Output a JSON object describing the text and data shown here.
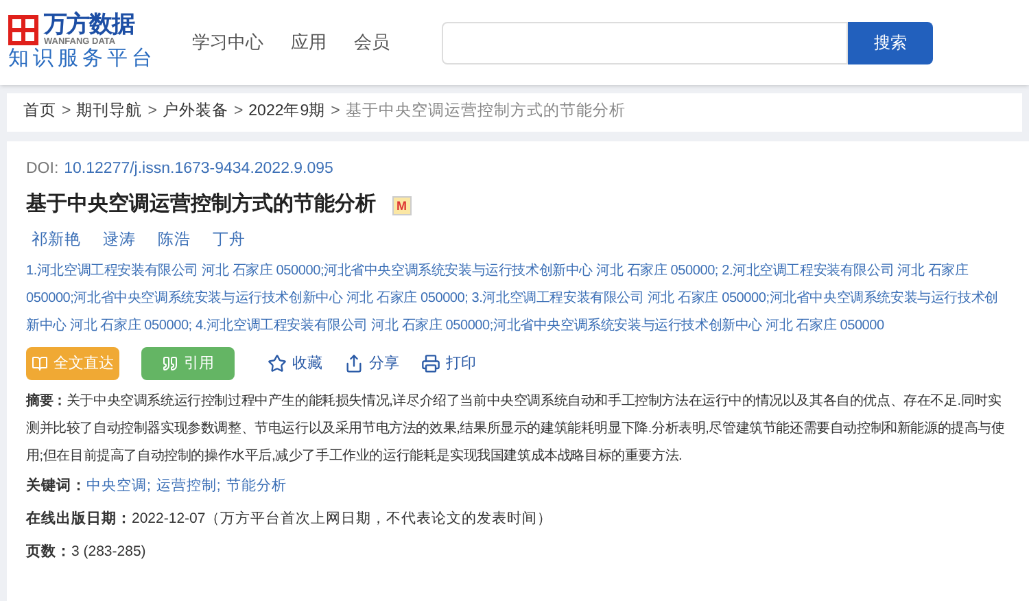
{
  "header": {
    "logo": {
      "name": "万方数据",
      "english": "WANFANG DATA",
      "subtitle": "知识服务平台"
    },
    "nav": [
      {
        "label": "学习中心"
      },
      {
        "label": "应用"
      },
      {
        "label": "会员"
      }
    ],
    "search": {
      "button": "搜索"
    }
  },
  "breadcrumb_separator": ">",
  "breadcrumb": [
    "首页",
    "期刊导航",
    "户外装备",
    "2022年9期",
    "基于中央空调运营控制方式的节能分析"
  ],
  "article": {
    "doi_label": "DOI:",
    "doi": "10.12277/j.issn.1673-9434.2022.9.095",
    "title": "基于中央空调运营控制方式的节能分析",
    "badge": "M",
    "authors": [
      "祁新艳",
      "逯涛",
      "陈浩",
      "丁舟"
    ],
    "affiliations": "1.河北空调工程安装有限公司 河北 石家庄 050000;河北省中央空调系统安装与运行技术创新中心 河北 石家庄 050000; 2.河北空调工程安装有限公司 河北 石家庄 050000;河北省中央空调系统安装与运行技术创新中心 河北 石家庄 050000; 3.河北空调工程安装有限公司 河北 石家庄 050000;河北省中央空调系统安装与运行技术创新中心 河北 石家庄 050000; 4.河北空调工程安装有限公司 河北 石家庄 050000;河北省中央空调系统安装与运行技术创新中心 河北 石家庄 050000",
    "buttons": [
      {
        "kind": "fulltext",
        "label": "全文直达"
      },
      {
        "kind": "cite",
        "label": "引用"
      }
    ],
    "actions": [
      {
        "kind": "star",
        "label": "收藏"
      },
      {
        "kind": "share",
        "label": "分享"
      },
      {
        "kind": "print",
        "label": "打印"
      }
    ],
    "abstract_label": "摘要：",
    "abstract": "关于中央空调系统运行控制过程中产生的能耗损失情况,详尽介绍了当前中央空调系统自动和手工控制方法在运行中的情况以及其各自的优点、存在不足.同时实测并比较了自动控制器实现参数调整、节电运行以及采用节电方法的效果,结果所显示的建筑能耗明显下降.分析表明,尽管建筑节能还需要自动控制和新能源的提高与使用;但在目前提高了自动控制的操作水平后,减少了手工作业的运行能耗是实现我国建筑成本战略目标的重要方法.",
    "keywords_label": "关键词：",
    "keywords": [
      "中央空调;",
      "运营控制;",
      "节能分析"
    ],
    "date_label": "在线出版日期：",
    "date": "2022-12-07（万方平台首次上网日期，不代表论文的发表时间）",
    "pages_label": "页数：",
    "pages": "3 (283-285)"
  }
}
